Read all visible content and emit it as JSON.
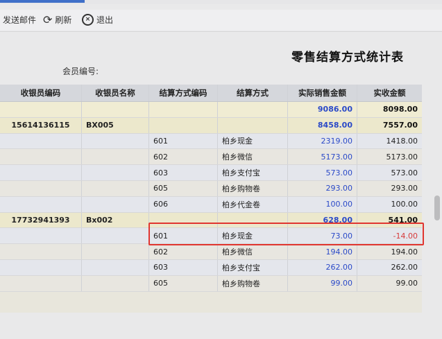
{
  "toolbar": {
    "send_mail": "发送邮件",
    "refresh": "刷新",
    "exit": "退出"
  },
  "report": {
    "title": "零售结算方式统计表",
    "member_label": "会员编号:"
  },
  "table": {
    "headers": [
      "收银员编码",
      "收银员名称",
      "结算方式编码",
      "结算方式",
      "实际销售金额",
      "实收金额"
    ],
    "total": {
      "sales": "9086.00",
      "received": "8098.00"
    },
    "groups": [
      {
        "cashier_code": "15614136115",
        "cashier_name": "BX005",
        "sales": "8458.00",
        "received": "7557.00",
        "rows": [
          {
            "code": "601",
            "method": "柏乡现金",
            "sales": "2319.00",
            "received": "1418.00"
          },
          {
            "code": "602",
            "method": "柏乡微信",
            "sales": "5173.00",
            "received": "5173.00"
          },
          {
            "code": "603",
            "method": "柏乡支付宝",
            "sales": "573.00",
            "received": "573.00"
          },
          {
            "code": "605",
            "method": "柏乡购物卷",
            "sales": "293.00",
            "received": "293.00"
          },
          {
            "code": "606",
            "method": "柏乡代金卷",
            "sales": "100.00",
            "received": "100.00"
          }
        ]
      },
      {
        "cashier_code": "17732941393",
        "cashier_name": "Bx002",
        "sales": "628.00",
        "received": "541.00",
        "rows": [
          {
            "code": "601",
            "method": "柏乡现金",
            "sales": "73.00",
            "received": "-14.00"
          },
          {
            "code": "602",
            "method": "柏乡微信",
            "sales": "194.00",
            "received": "194.00"
          },
          {
            "code": "603",
            "method": "柏乡支付宝",
            "sales": "262.00",
            "received": "262.00"
          },
          {
            "code": "605",
            "method": "柏乡购物卷",
            "sales": "99.00",
            "received": "99.00"
          }
        ]
      }
    ]
  },
  "colors": {
    "accent": "#3f6fc8",
    "sales_text": "#2a49c8",
    "negative": "#d63a3a",
    "highlight_box": "#e0352f"
  }
}
